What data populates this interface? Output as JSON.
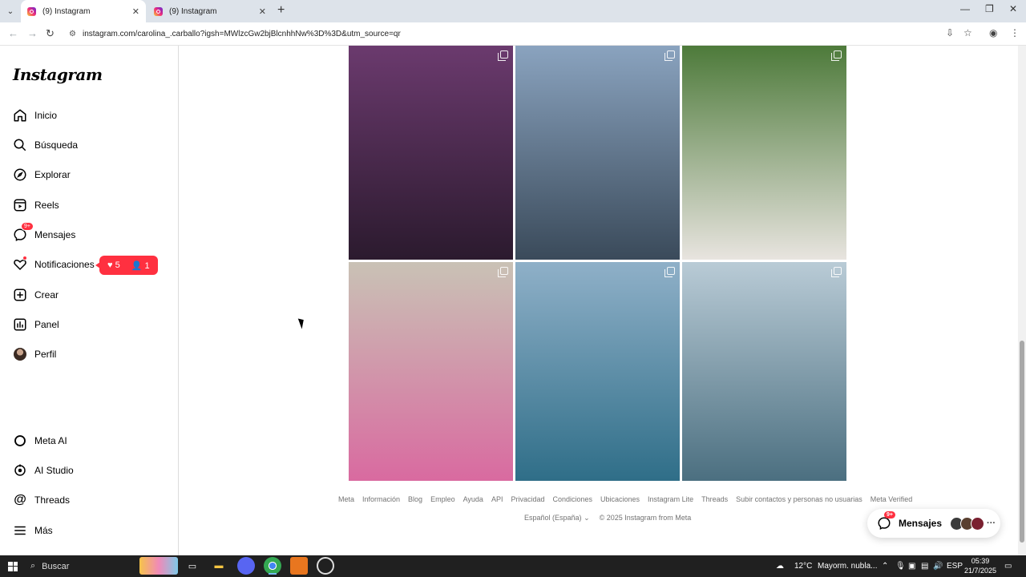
{
  "browser": {
    "tabs": [
      {
        "title": "(9) Instagram",
        "active": true
      },
      {
        "title": "(9) Instagram",
        "active": false
      }
    ],
    "url": "instagram.com/carolina_.carballo?igsh=MWlzcGw2bjBlcnhhNw%3D%3D&utm_source=qr"
  },
  "sidebar": {
    "logo": "Instagram",
    "items": [
      {
        "label": "Inicio",
        "icon": "home-icon"
      },
      {
        "label": "Búsqueda",
        "icon": "search-icon"
      },
      {
        "label": "Explorar",
        "icon": "compass-icon"
      },
      {
        "label": "Reels",
        "icon": "reels-icon"
      },
      {
        "label": "Mensajes",
        "icon": "messenger-icon",
        "badge": "9+"
      },
      {
        "label": "Notificaciones",
        "icon": "heart-icon"
      },
      {
        "label": "Crear",
        "icon": "plus-square-icon"
      },
      {
        "label": "Panel",
        "icon": "dashboard-icon"
      },
      {
        "label": "Perfil",
        "icon": "avatar"
      }
    ],
    "bottom_items": [
      {
        "label": "Meta AI",
        "icon": "meta-ai-icon"
      },
      {
        "label": "AI Studio",
        "icon": "ai-studio-icon"
      },
      {
        "label": "Threads",
        "icon": "threads-icon"
      },
      {
        "label": "Más",
        "icon": "menu-icon"
      }
    ],
    "notification_popup": {
      "likes": "5",
      "follows": "1"
    }
  },
  "posts": [
    {
      "alt": "photo-1",
      "colors": [
        "#6b3a6e",
        "#2b1a2e"
      ]
    },
    {
      "alt": "photo-2",
      "colors": [
        "#8aa3bf",
        "#3a4a5a"
      ]
    },
    {
      "alt": "photo-3",
      "colors": [
        "#4d7a3a",
        "#e8e4df"
      ]
    },
    {
      "alt": "photo-4",
      "colors": [
        "#c9c2b5",
        "#d96aa0"
      ]
    },
    {
      "alt": "photo-5",
      "colors": [
        "#8fb0c8",
        "#2f6e88"
      ]
    },
    {
      "alt": "photo-6",
      "colors": [
        "#b9cbd6",
        "#4b6f80"
      ]
    }
  ],
  "footer": {
    "links": [
      "Meta",
      "Información",
      "Blog",
      "Empleo",
      "Ayuda",
      "API",
      "Privacidad",
      "Condiciones",
      "Ubicaciones",
      "Instagram Lite",
      "Threads",
      "Subir contactos y personas no usuarias",
      "Meta Verified"
    ],
    "language": "Español (España)",
    "copyright": "© 2025 Instagram from Meta"
  },
  "messages_pill": {
    "label": "Mensajes",
    "badge": "9+"
  },
  "taskbar": {
    "search": "Buscar",
    "weather": "12°C",
    "weather_desc": "Mayorm. nubla...",
    "lang": "ESP",
    "time": "05:39",
    "date": "21/7/2025"
  }
}
